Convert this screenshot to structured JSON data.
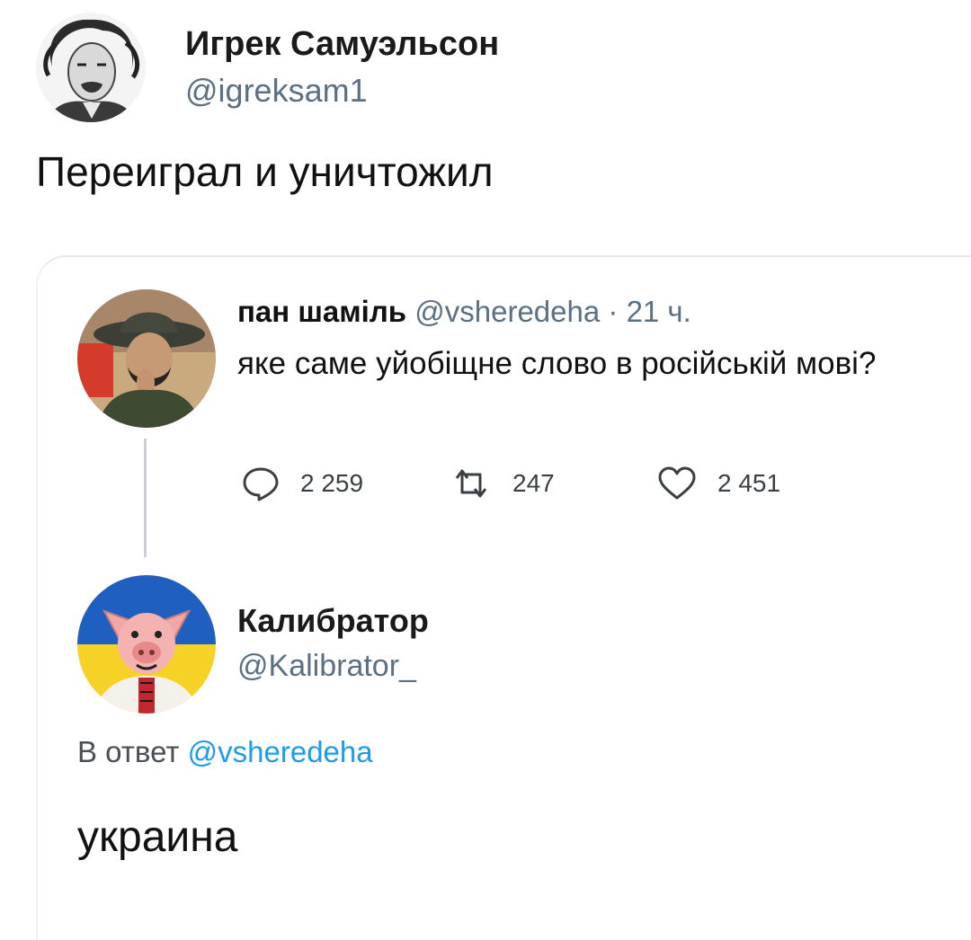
{
  "tweet": {
    "author_name": "Игрек Самуэльсон",
    "author_handle": "@igreksam1",
    "text": "Переиграл и уничтожил"
  },
  "quoted_tweet": {
    "author_name": "пан шаміль",
    "author_handle": "@vsheredeha",
    "separator": "·",
    "time": "21 ч.",
    "text": "яке саме уйобіщне слово в російській мові?",
    "actions": {
      "replies": "2 259",
      "retweets": "247",
      "likes": "2 451"
    }
  },
  "reply": {
    "author_name": "Калибратор",
    "author_handle": "@Kalibrator_",
    "reply_prefix": "В ответ",
    "reply_to_handle": "@vsheredeha",
    "text": "украина"
  },
  "colors": {
    "link": "#1d9bf0",
    "muted": "#5b7083",
    "flag_blue": "#1f5fbf",
    "flag_yellow": "#f5d225"
  },
  "icons": {
    "reply": "speech-bubble-icon",
    "retweet": "retweet-icon",
    "like": "heart-icon"
  }
}
